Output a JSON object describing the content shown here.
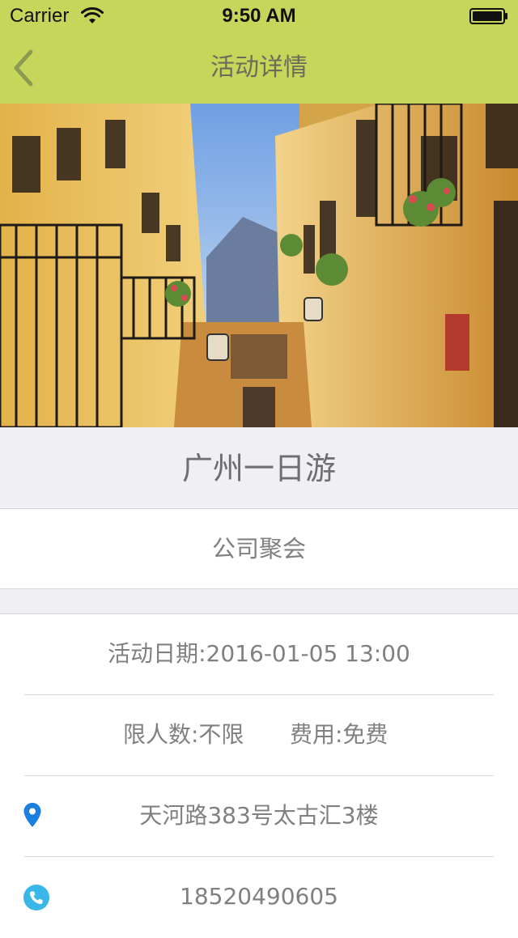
{
  "status_bar": {
    "carrier": "Carrier",
    "time": "9:50 AM",
    "wifi_icon": "wifi-icon",
    "battery_icon": "battery-icon"
  },
  "nav": {
    "title": "活动详情",
    "back_icon": "chevron-left-icon",
    "bar_color": "#c6d65a"
  },
  "event": {
    "title": "广州一日游",
    "category": "公司聚会",
    "date": "活动日期:2016-01-05 13:00",
    "limit": "限人数:不限",
    "fee": "费用:免费",
    "address": "天河路383号太古汇3楼",
    "phone": "18520490605"
  },
  "colors": {
    "accent": "#c6d65a",
    "icon_blue": "#1b7fe0",
    "icon_teal": "#39b7e8",
    "section_bg": "#efeff4"
  }
}
